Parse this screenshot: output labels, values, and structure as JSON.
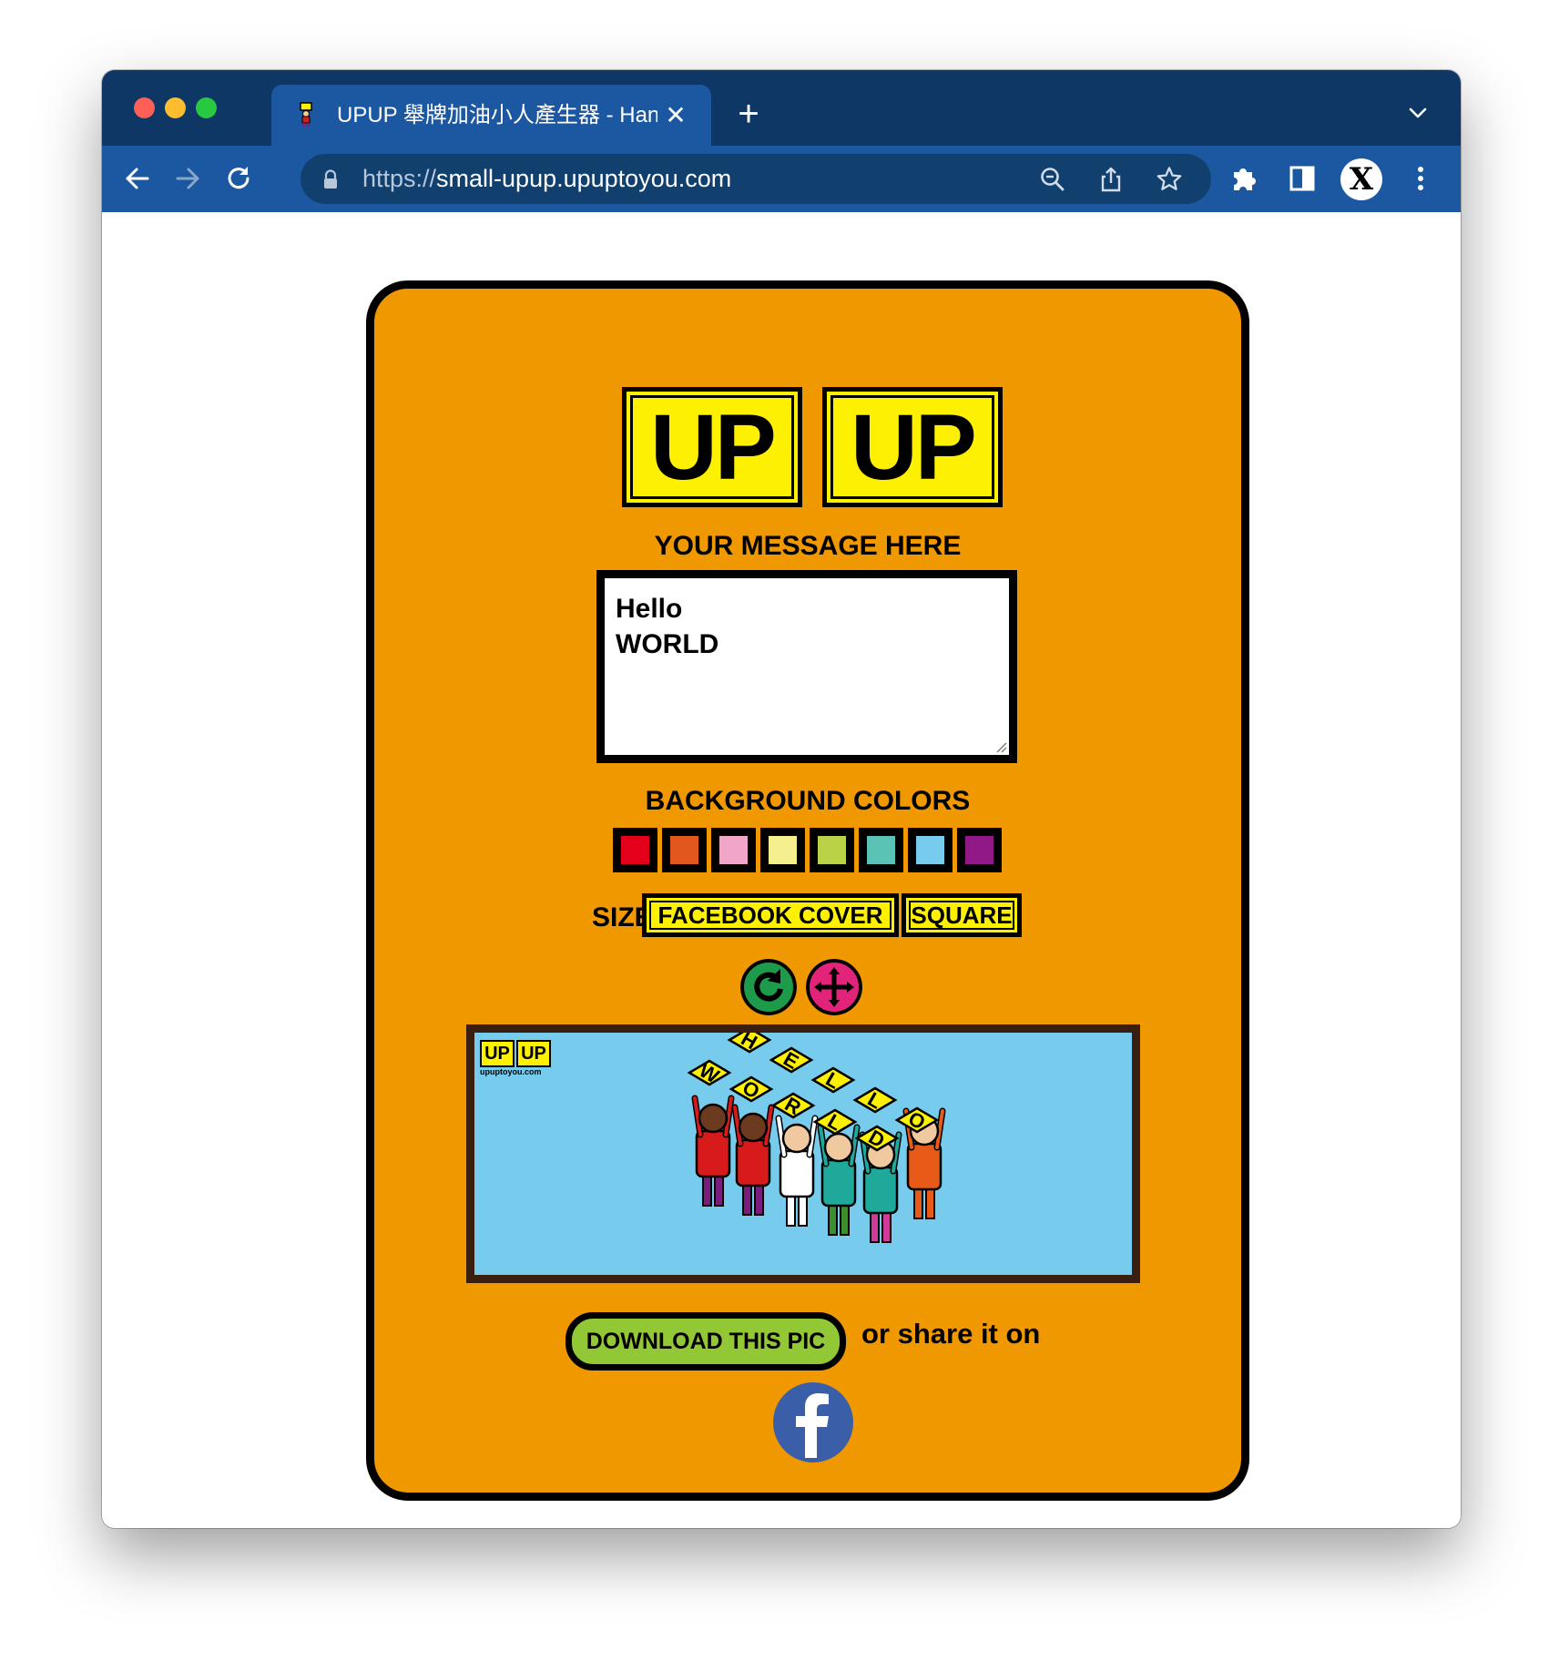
{
  "browser": {
    "tab_title": "UPUP 舉牌加油小人產生器 - Hand",
    "tab_close": "✕",
    "new_tab": "+",
    "url_scheme": "https://",
    "url_host": "small-upup.upuptoyou.com",
    "profile_initial": "X"
  },
  "page": {
    "logo_left": "UP",
    "logo_right": "UP",
    "message_label": "YOUR MESSAGE HERE",
    "message_value": "Hello\nWORLD",
    "bg_colors_label": "BACKGROUND COLORS",
    "bg_colors": [
      "#e4001b",
      "#e2571d",
      "#f2a6c7",
      "#f5ef8d",
      "#b9d246",
      "#5bc3b6",
      "#77ccee",
      "#901887"
    ],
    "size_label": "SIZE",
    "size_options": [
      "FACEBOOK COVER",
      "SQUARE"
    ],
    "refresh_icon": "refresh-icon",
    "move_icon": "move-icon",
    "preview": {
      "logo_left": "UP",
      "logo_right": "UP",
      "logo_sub": "upuptoyou.com",
      "sign_letters_top": [
        "H",
        "E",
        "L",
        "L",
        "O"
      ],
      "sign_letters_bottom": [
        "W",
        "O",
        "R",
        "L",
        "D"
      ],
      "background": "#77ccee"
    },
    "download_label": "DOWNLOAD THIS PIC",
    "share_text": "or share it on",
    "share_icon": "facebook-icon"
  },
  "colors": {
    "card_bg": "#ef9800",
    "accent_yellow": "#fef001",
    "browser_tabbar": "#0e3766",
    "browser_toolbar": "#1c58a1",
    "download_green": "#92c735"
  }
}
